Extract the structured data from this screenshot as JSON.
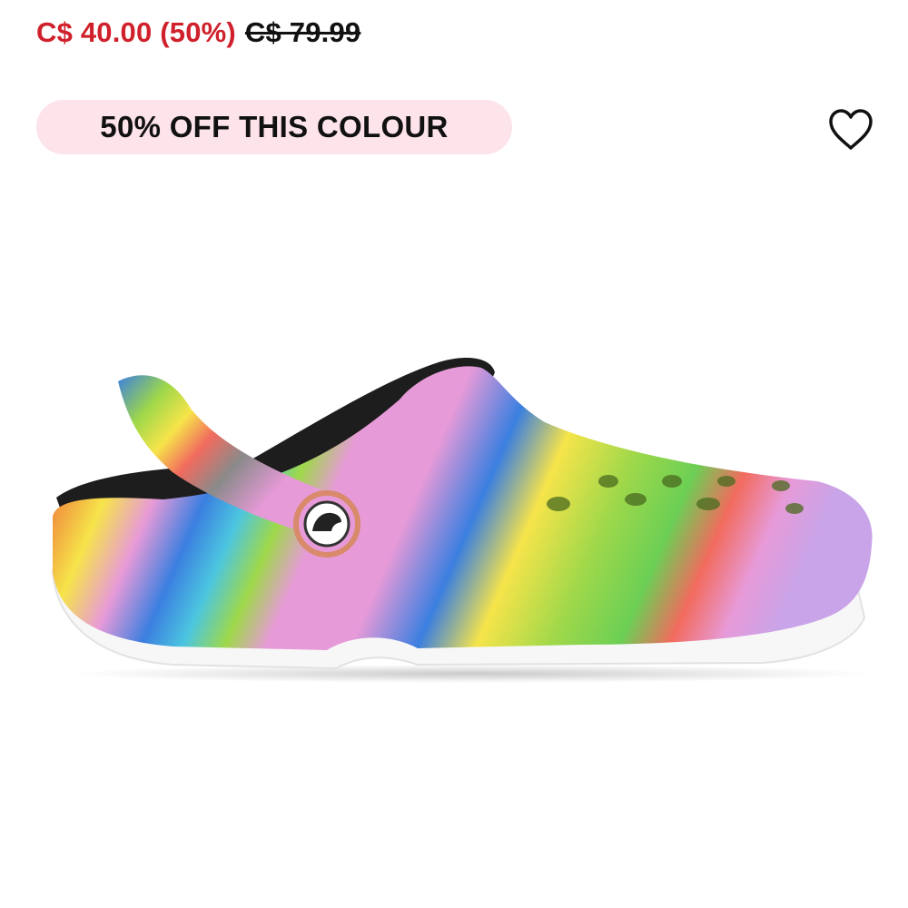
{
  "price": {
    "sale": "C$ 40.00 (50%)",
    "original": "C$ 79.99"
  },
  "promo": {
    "label": "50% OFF THIS COLOUR"
  },
  "wishlist": {
    "icon": "heart-outline-icon"
  },
  "product": {
    "image": "rainbow-lined-clog",
    "colors": [
      "#f6e44a",
      "#f08a3c",
      "#3b7fe0",
      "#4cc6e0",
      "#e79ad8",
      "#9fd84a",
      "#f26b5e",
      "#3a3a3a"
    ]
  },
  "theme": {
    "sale_color": "#d0202b",
    "badge_bg": "#fde3ea"
  }
}
